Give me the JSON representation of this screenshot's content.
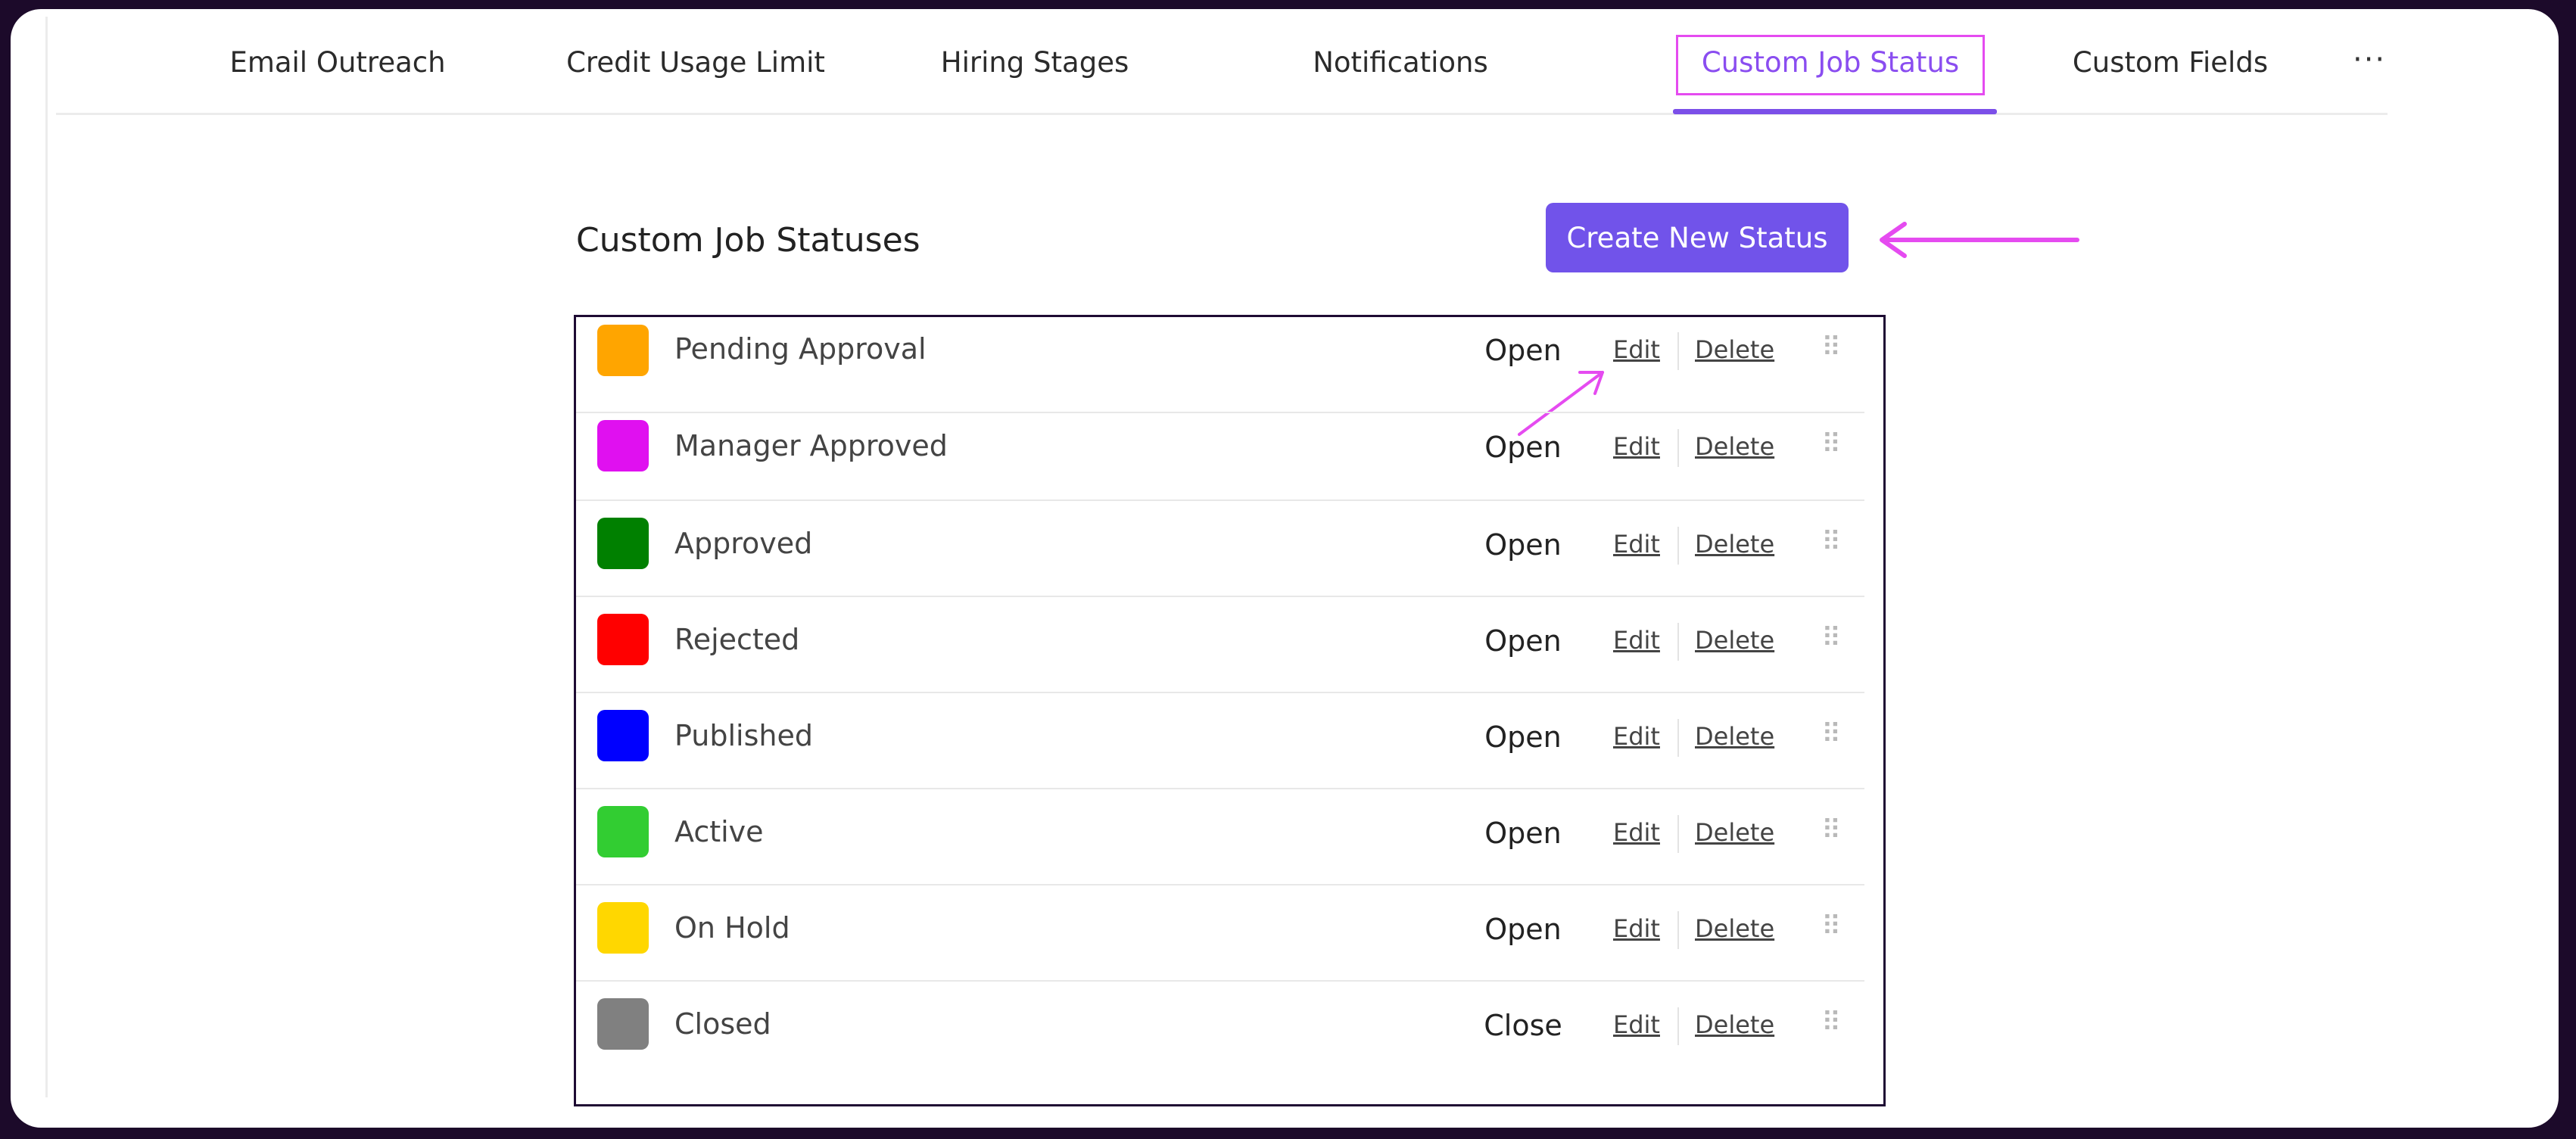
{
  "tabs": [
    {
      "label": "Email Outreach"
    },
    {
      "label": "Credit Usage Limit"
    },
    {
      "label": "Hiring Stages"
    },
    {
      "label": "Notifications"
    },
    {
      "label": "Custom Job Status"
    },
    {
      "label": "Custom Fields"
    }
  ],
  "more_label": "···",
  "section": {
    "title": "Custom Job Statuses",
    "create_button": "Create New Status"
  },
  "actions": {
    "edit": "Edit",
    "delete": "Delete"
  },
  "statuses": [
    {
      "name": "Pending Approval",
      "state": "Open",
      "color": "#FFA500"
    },
    {
      "name": "Manager Approved",
      "state": "Open",
      "color": "#E010F0"
    },
    {
      "name": "Approved",
      "state": "Open",
      "color": "#008000"
    },
    {
      "name": "Rejected",
      "state": "Open",
      "color": "#FF0000"
    },
    {
      "name": "Published",
      "state": "Open",
      "color": "#0000FF"
    },
    {
      "name": "Active",
      "state": "Open",
      "color": "#32CD32"
    },
    {
      "name": "On Hold",
      "state": "Open",
      "color": "#FFD700"
    },
    {
      "name": "Closed",
      "state": "Close",
      "color": "#808080"
    }
  ],
  "colors": {
    "accent": "#7153EA",
    "highlight": "#E54BF0"
  }
}
